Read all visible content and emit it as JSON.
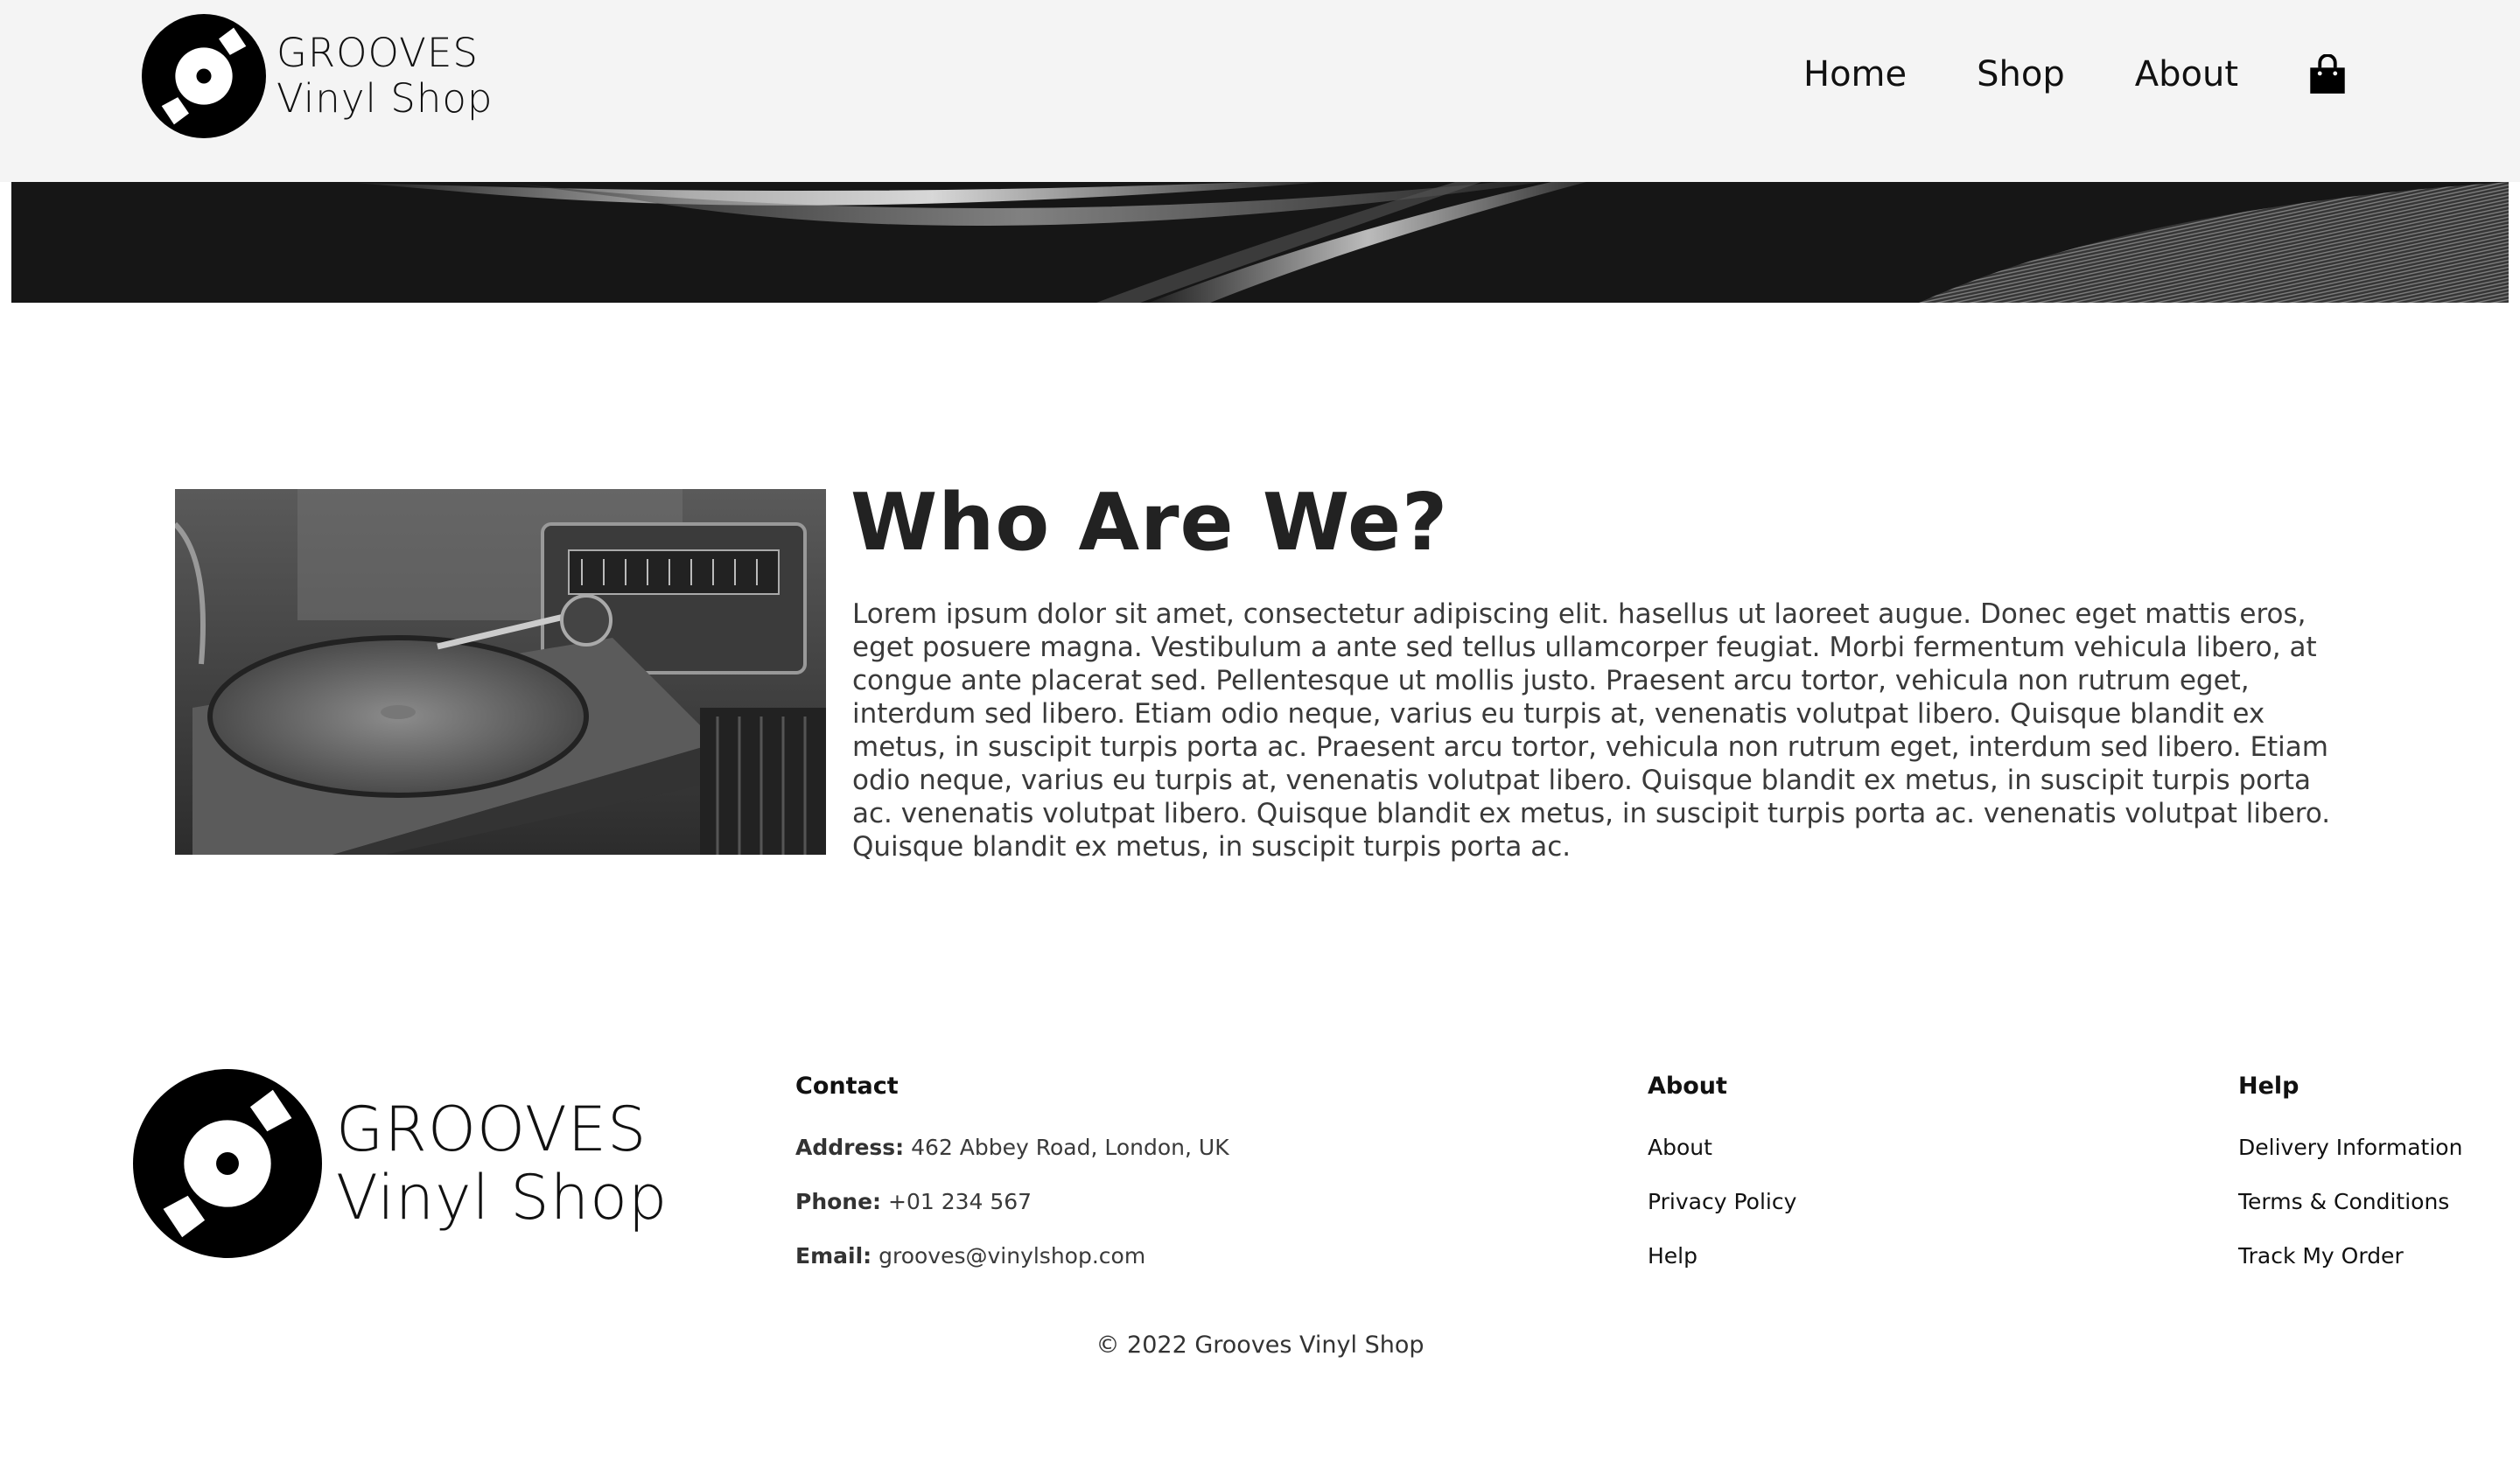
{
  "brand": {
    "line1": "GROOVES",
    "line2": "Vinyl Shop"
  },
  "nav": {
    "home": "Home",
    "shop": "Shop",
    "about": "About",
    "cart_icon": "shopping-bag-icon"
  },
  "about": {
    "title": "Who Are We?",
    "body": "Lorem ipsum dolor sit amet, consectetur adipiscing elit. hasellus ut laoreet augue. Donec eget mattis eros, eget posuere magna. Vestibulum a ante sed tellus ullamcorper feugiat. Morbi fermentum vehicula libero, at congue ante placerat sed. Pellentesque ut mollis justo. Praesent arcu tortor, vehicula non rutrum eget, interdum sed libero. Etiam odio neque, varius eu turpis at, venenatis volutpat libero. Quisque blandit ex metus, in suscipit turpis porta ac. Praesent arcu tortor, vehicula non rutrum eget, interdum sed libero. Etiam odio neque, varius eu turpis at, venenatis volutpat libero. Quisque blandit ex metus, in suscipit turpis porta ac. venenatis volutpat libero. Quisque blandit ex metus, in suscipit turpis porta ac. venenatis volutpat libero. Quisque blandit ex metus, in suscipit turpis porta ac."
  },
  "footer": {
    "contact": {
      "heading": "Contact",
      "address_label": "Address:",
      "address": "462 Abbey Road, London, UK",
      "phone_label": "Phone:",
      "phone": "+01 234 567",
      "email_label": "Email:",
      "email": "grooves@vinylshop.com"
    },
    "about": {
      "heading": "About",
      "links": [
        "About",
        "Privacy Policy",
        "Help"
      ]
    },
    "help": {
      "heading": "Help",
      "links": [
        "Delivery Information",
        "Terms & Conditions",
        "Track My Order"
      ]
    },
    "copyright": "© 2022 Grooves Vinyl Shop"
  },
  "colors": {
    "header_bg": "#f4f4f4",
    "hero_bg": "#161616",
    "text_dark": "#222222",
    "text_body": "#3a3a3a"
  }
}
